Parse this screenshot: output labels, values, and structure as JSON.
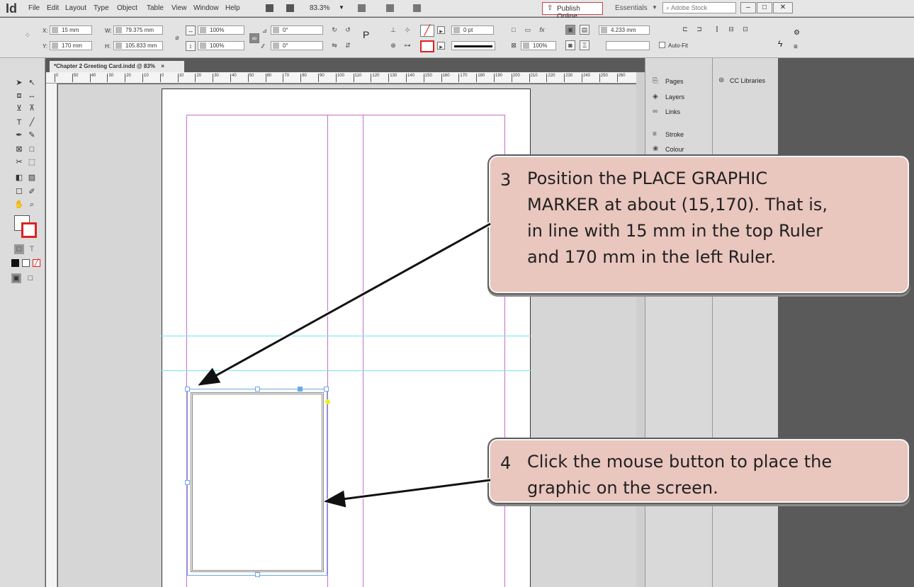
{
  "app": {
    "logo": "Id"
  },
  "menu": [
    "File",
    "Edit",
    "Layout",
    "Type",
    "Object",
    "Table",
    "View",
    "Window",
    "Help"
  ],
  "zoom": "83.3%",
  "publish_label": "Publish Online",
  "workspace": "Essentials",
  "stock_search_placeholder": "Adobe Stock",
  "control": {
    "x_label": "X:",
    "x_value": "15 mm",
    "y_label": "Y:",
    "y_value": "170 mm",
    "w_label": "W:",
    "w_value": "79.375 mm",
    "h_label": "H:",
    "h_value": "105.833 mm",
    "scale_x": "100%",
    "scale_y": "100%",
    "rotate": "0°",
    "shear": "0°",
    "stroke_weight": "0 pt",
    "opacity": "100%",
    "offset": "4.233 mm",
    "autofit": "Auto-Fit"
  },
  "tab_label": "*Chapter 2 Greeting Card.indd @ 83%",
  "ruler_ticks": [
    "0",
    "50",
    "40",
    "30",
    "20",
    "10",
    "0",
    "10",
    "20",
    "30",
    "40",
    "50",
    "60",
    "70",
    "80",
    "90",
    "100",
    "110",
    "120",
    "130",
    "140",
    "150",
    "160",
    "170",
    "180",
    "190",
    "200",
    "210",
    "220",
    "230",
    "240",
    "250",
    "260"
  ],
  "panels": {
    "items": [
      "Pages",
      "Layers",
      "Links",
      "Stroke",
      "Colour"
    ],
    "libraries": "CC Libraries"
  },
  "callouts": [
    {
      "num": "3",
      "lines": [
        "Position the PLACE GRAPHIC",
        "MARKER at about (15,170). That is,",
        "in line with 15 mm in the top Ruler",
        "and 170 mm in the left Ruler."
      ]
    },
    {
      "num": "4",
      "lines": [
        "Click the mouse button to place the",
        "graphic on the screen."
      ]
    }
  ],
  "colors": {
    "callout_fill": "#e9c6be",
    "margin_guide": "#c86ec8",
    "ruler_guide": "#6fe6f0",
    "frame_select": "#6aa8e8"
  }
}
